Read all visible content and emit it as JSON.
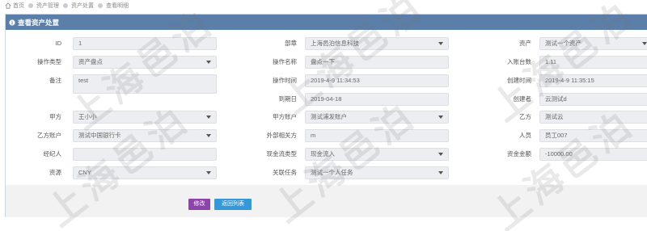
{
  "breadcrumb": {
    "items": [
      "首页",
      "资产管理",
      "资产处置",
      "查看明细"
    ]
  },
  "panel": {
    "title": "查看资产处置"
  },
  "form": {
    "col1": [
      {
        "label": "ID",
        "value": "1",
        "type": "text"
      },
      {
        "label": "操作类型",
        "value": "资产盘点",
        "type": "select"
      },
      {
        "label": "备注",
        "value": "test",
        "type": "textarea"
      },
      {
        "label": "甲方",
        "value": "王小小",
        "type": "select"
      },
      {
        "label": "乙方账户",
        "value": "测试中国银行卡",
        "type": "select"
      },
      {
        "label": "经纪人",
        "value": "",
        "type": "text"
      },
      {
        "label": "资源",
        "value": "CNY",
        "type": "select"
      }
    ],
    "col2": [
      {
        "label": "部章",
        "value": "上海邑泊信息科技",
        "type": "select"
      },
      {
        "label": "操作名称",
        "value": "盘点一下",
        "type": "text"
      },
      {
        "label": "操作时间",
        "value": "2019-4-9 11:34:53",
        "type": "text"
      },
      {
        "label": "到期日",
        "value": "2019-04-18",
        "type": "text"
      },
      {
        "label": "甲方账户",
        "value": "测试浦发账户",
        "type": "select"
      },
      {
        "label": "外部相关方",
        "value": "m",
        "type": "text"
      },
      {
        "label": "现金流类型",
        "value": "现金流入",
        "type": "select"
      },
      {
        "label": "关联任务",
        "value": "测试一个人任务",
        "type": "select"
      }
    ],
    "col3": [
      {
        "label": "资产",
        "value": "测试一个资产",
        "type": "select"
      },
      {
        "label": "入账台数",
        "value": "1.11",
        "type": "text"
      },
      {
        "label": "创建时间",
        "value": "2019-4-9 11:35:15",
        "type": "text"
      },
      {
        "label": "创建者",
        "value": "云测试d",
        "type": "text"
      },
      {
        "label": "乙方",
        "value": "测试云",
        "type": "text"
      },
      {
        "label": "人员",
        "value": "员工007",
        "type": "text"
      },
      {
        "label": "资金金额",
        "value": "-10000.00",
        "type": "text"
      }
    ]
  },
  "buttons": {
    "edit": "修改",
    "back": "返回列表"
  },
  "watermark": "上海邑泊"
}
